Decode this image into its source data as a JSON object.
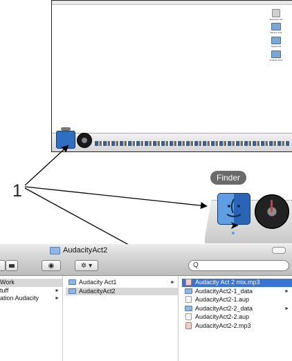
{
  "callout_number": "1",
  "desktop": {
    "icons": [
      {
        "label": "Macintosh HD",
        "kind": "hd"
      },
      {
        "label": "Backup Audi",
        "kind": "folder"
      },
      {
        "label": "Digital Folk",
        "kind": "folder"
      },
      {
        "label": "Audacity Work",
        "kind": "folder"
      }
    ]
  },
  "dock_zoom": {
    "tooltip": "Finder"
  },
  "finder_window": {
    "title": "AudacityAct2",
    "search": {
      "placeholder": "Q"
    },
    "toolbar": {
      "eye": "◉",
      "action": "✲ ▾"
    },
    "columns": [
      {
        "items": [
          {
            "label": "Work",
            "arrow": "",
            "selected": "grey"
          },
          {
            "label": "tuff",
            "arrow": "►",
            "selected": ""
          },
          {
            "label": "ation Audacity",
            "arrow": "►",
            "selected": ""
          }
        ]
      },
      {
        "items": [
          {
            "label": "Audacity Act1",
            "icon": "folder",
            "arrow": "►",
            "selected": ""
          },
          {
            "label": "AudacityAct2",
            "icon": "folder",
            "arrow": "",
            "selected": "grey"
          }
        ]
      },
      {
        "items": [
          {
            "label": "Audacity Act 2 mix.mp3",
            "icon": "audio",
            "arrow": "",
            "selected": "blue"
          },
          {
            "label": "AudacityAct2-1_data",
            "icon": "folder",
            "arrow": "►",
            "selected": ""
          },
          {
            "label": "AudacityAct2-1.aup",
            "icon": "doc",
            "arrow": "",
            "selected": ""
          },
          {
            "label": "AudacityAct2-2_data",
            "icon": "folder",
            "arrow": "►",
            "selected": ""
          },
          {
            "label": "AudacityAct2-2.aup",
            "icon": "doc",
            "arrow": "",
            "selected": ""
          },
          {
            "label": "AudacityAct2-2.mp3",
            "icon": "audio",
            "arrow": "",
            "selected": ""
          }
        ]
      }
    ]
  },
  "colors": {
    "selection_blue": "#3874d7",
    "finder_blue": "#2f6fc1"
  }
}
